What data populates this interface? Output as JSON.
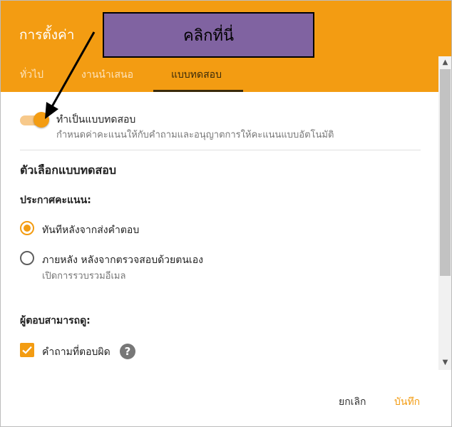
{
  "dialog": {
    "title": "การตั้งค่า",
    "tabs": [
      {
        "label": "ทั่วไป"
      },
      {
        "label": "งานนำเสนอ"
      },
      {
        "label": "แบบทดสอบ"
      }
    ]
  },
  "annotation": {
    "callout_text": "คลิกที่นี่"
  },
  "quiz_toggle": {
    "label": "ทำเป็นแบบทดสอบ",
    "description": "กำหนดค่าคะแนนให้กับคำถามและอนุญาตการให้คะแนนแบบอัตโนมัติ",
    "enabled": true
  },
  "quiz_options": {
    "title": "ตัวเลือกแบบทดสอบ",
    "release_grade": {
      "label": "ประกาศคะแนน:",
      "options": [
        {
          "label": "ทันทีหลังจากส่งคำตอบ",
          "selected": true
        },
        {
          "label": "ภายหลัง หลังจากตรวจสอบด้วยตนเอง",
          "sublabel": "เปิดการรวบรวมอีเมล",
          "selected": false
        }
      ]
    },
    "respondent_can_see": {
      "label": "ผู้ตอบสามารถดู:",
      "items": [
        {
          "label": "คำถามที่ตอบผิด",
          "checked": true
        }
      ]
    }
  },
  "footer": {
    "cancel_label": "ยกเลิก",
    "save_label": "บันทึก"
  },
  "icons": {
    "help": "help-circle-icon",
    "check": "check-icon",
    "scroll_up": "chevron-up-icon",
    "scroll_down": "chevron-down-icon"
  },
  "colors": {
    "accent": "#f39c12",
    "callout_bg": "#8063a1"
  }
}
